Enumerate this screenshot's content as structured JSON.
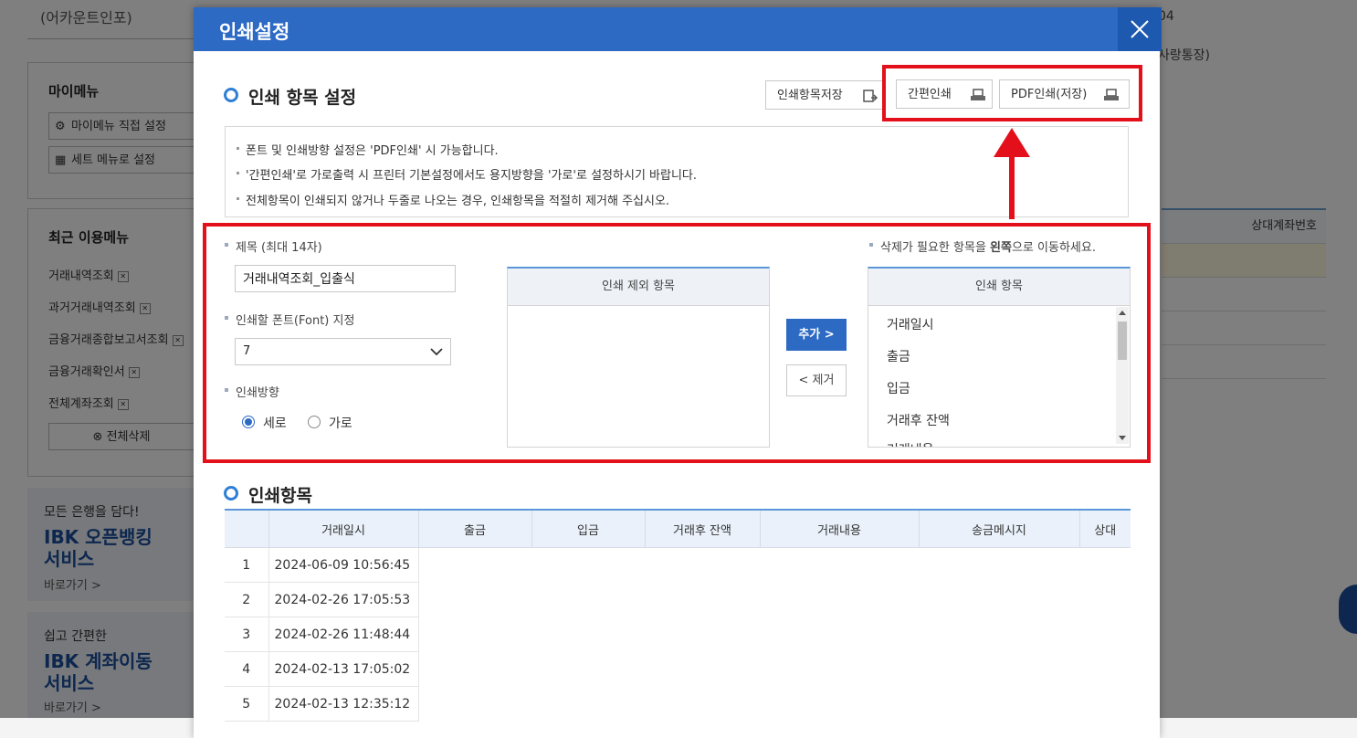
{
  "background": {
    "account_info": "(어카운트인포)",
    "my_menu": {
      "title": "마이메뉴",
      "direct_setting_label": "마이메뉴 직접 설정",
      "set_menu_label": "세트 메뉴로 설정"
    },
    "recent_menu": {
      "title": "최근 이용메뉴",
      "items": [
        "거래내역조회",
        "과거거래내역조회",
        "금융거래종합보고서조회",
        "금융거래확인서",
        "전체계좌조회"
      ],
      "delete_all_label": "전체삭제"
    },
    "ad1": {
      "small": "모든 은행을 담다!",
      "big_line1": "IBK 오픈뱅킹",
      "big_line2": "서비스",
      "go": "바로가기 >"
    },
    "ad2": {
      "small": "쉽고 간편한",
      "big_line1": "IBK 계좌이동",
      "big_line2": "서비스",
      "go": "바로가기 >"
    },
    "right_date_fragment": "04",
    "right_account_fragment": "사랑통장)",
    "right_table_header": "상대계좌번호"
  },
  "modal": {
    "title": "인쇄설정",
    "settings_section_title": "인쇄 항목 설정",
    "buttons": {
      "save_items": "인쇄항목저장",
      "simple_print": "간편인쇄",
      "pdf_print": "PDF인쇄(저장)"
    },
    "notices": [
      "폰트 및 인쇄방향 설정은 'PDF인쇄' 시 가능합니다.",
      "'간편인쇄'로 가로출력 시 프린터 기본설정에서도 용지방향을 '가로'로 설정하시기 바랍니다.",
      "전체항목이 인쇄되지 않거나 두줄로 나오는 경우, 인쇄항목을 적절히 제거해 주십시오."
    ],
    "form": {
      "title_label": "제목 (최대 14자)",
      "title_value": "거래내역조회_입출식",
      "font_label": "인쇄할 폰트(Font) 지정",
      "font_value": "7",
      "orientation_label": "인쇄방향",
      "orientation_options": [
        "세로",
        "가로"
      ],
      "orientation_selected": "세로"
    },
    "hint": {
      "prefix": "삭제가 필요한 항목을 ",
      "bold": "왼쪽",
      "suffix": "으로 이동하세요."
    },
    "excluded_list_header": "인쇄 제외 항목",
    "included_list_header": "인쇄 항목",
    "included_items": [
      "거래일시",
      "출금",
      "입금",
      "거래후 잔액",
      "거래내용"
    ],
    "add_button": "추가 >",
    "remove_button": "< 제거",
    "items_section_title": "인쇄항목",
    "table": {
      "columns": [
        "",
        "거래일시",
        "출금",
        "입금",
        "거래후 잔액",
        "거래내용",
        "송금메시지",
        "상대"
      ],
      "rows": [
        [
          "1",
          "2024-06-09 10:56:45"
        ],
        [
          "2",
          "2024-02-26 17:05:53"
        ],
        [
          "3",
          "2024-02-26 11:48:44"
        ],
        [
          "4",
          "2024-02-13 17:05:02"
        ],
        [
          "5",
          "2024-02-13 12:35:12"
        ]
      ]
    }
  },
  "colors": {
    "header_blue": "#2d6ac4",
    "highlight_red": "#e3101b"
  }
}
